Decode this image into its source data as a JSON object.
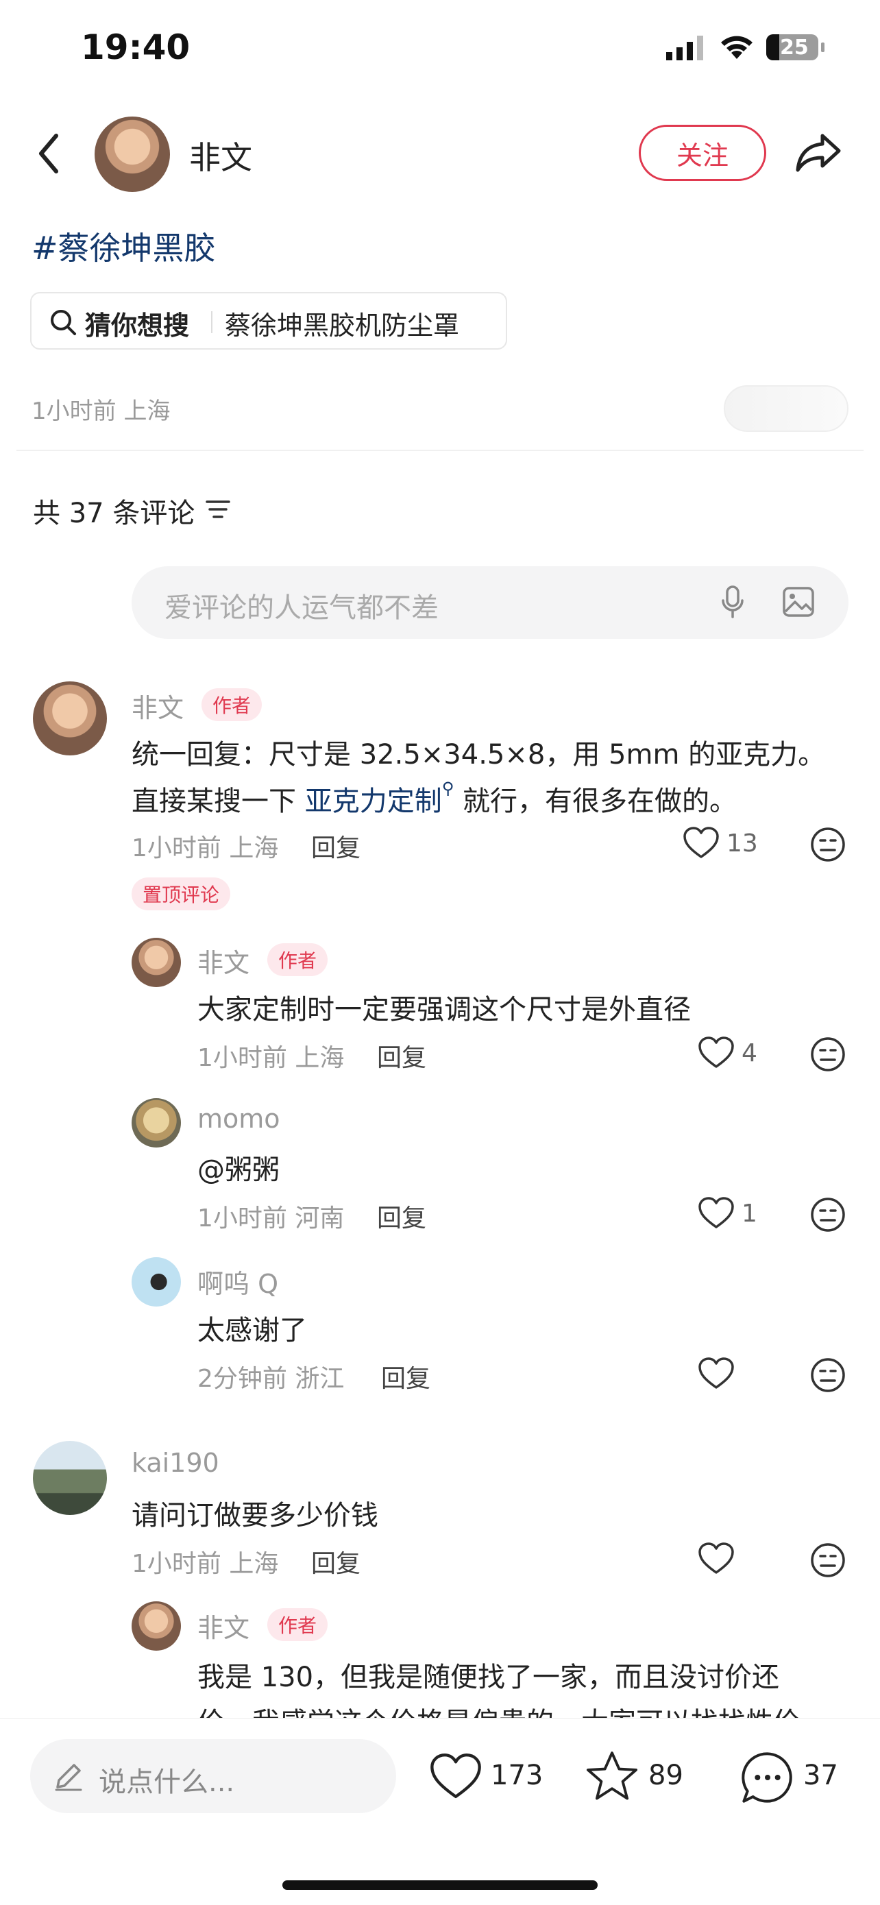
{
  "status_bar": {
    "time": "19:40",
    "battery": "25"
  },
  "header": {
    "author_name": "非文",
    "follow_label": "关注"
  },
  "post": {
    "hashtag": "#蔡徐坤黑胶",
    "suggest_label": "猜你想搜",
    "suggest_query": "蔡徐坤黑胶机防尘罩",
    "meta": "1小时前 上海"
  },
  "comments_section": {
    "count_label": "共 37 条评论",
    "input_placeholder": "爱评论的人运气都不差"
  },
  "comments": [
    {
      "name": "非文",
      "badge": "作者",
      "text_line1": "统一回复：尺寸是 32.5×34.5×8，用 5mm 的亚克力。",
      "text_line2_a": "直接某搜一下 ",
      "text_line2_link": "亚克力定制",
      "text_line2_b": " 就行，有很多在做的。",
      "meta": "1小时前 上海",
      "reply": "回复",
      "likes": "13",
      "pinned": "置顶评论"
    },
    {
      "name": "非文",
      "badge": "作者",
      "text": "大家定制时一定要强调这个尺寸是外直径",
      "meta": "1小时前 上海",
      "reply": "回复",
      "likes": "4"
    },
    {
      "name": "momo",
      "text": "@粥粥",
      "meta": "1小时前 河南",
      "reply": "回复",
      "likes": "1"
    },
    {
      "name": "啊呜 Q",
      "text": "太感谢了",
      "meta": "2分钟前 浙江",
      "reply": "回复"
    },
    {
      "name": "kai190",
      "text": "请问订做要多少价钱",
      "meta": "1小时前 上海",
      "reply": "回复"
    },
    {
      "name": "非文",
      "badge": "作者",
      "text_line1": "我是 130，但我是随便找了一家，而且没讨价还",
      "text_line2": "价，我感觉这个价格是偏贵的，大家可以找找性价"
    }
  ],
  "bottom_bar": {
    "input_placeholder": "说点什么...",
    "likes": "173",
    "stars": "89",
    "comments": "37"
  },
  "icons": [
    "back-icon",
    "share-icon",
    "search-icon",
    "filter-icon",
    "microphone-icon",
    "image-icon",
    "heart-icon",
    "emoji-icon",
    "pencil-icon",
    "star-icon",
    "comment-icon"
  ],
  "colors": {
    "accent": "#e0394f",
    "link": "#13386c",
    "muted": "#9a9a9a"
  }
}
